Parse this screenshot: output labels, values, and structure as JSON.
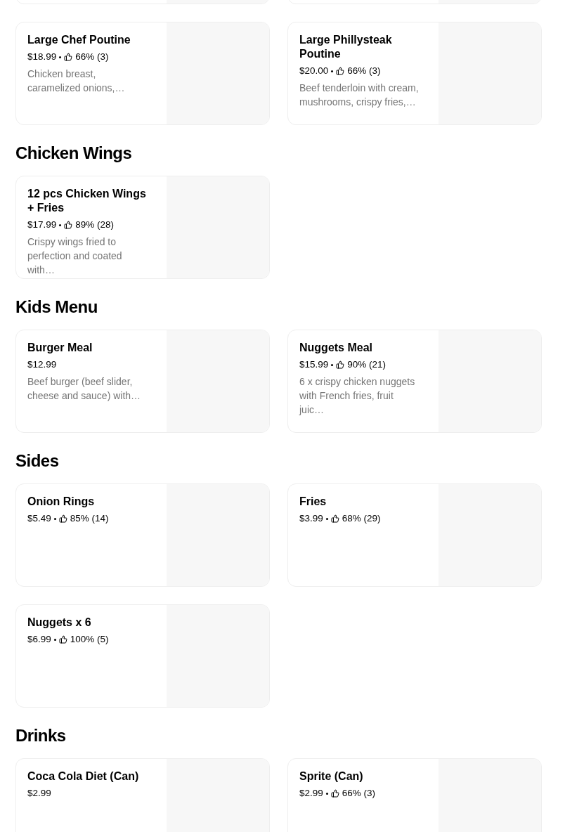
{
  "sections": [
    {
      "items": [
        {
          "name": "Large Chef Poutine",
          "price": "$18.99",
          "rating": "66% (3)",
          "description": "Chicken breast, caramelized onions,…"
        },
        {
          "name": "Large Phillysteak Poutine",
          "price": "$20.00",
          "rating": "66% (3)",
          "description": "Beef tenderloin with cream, mushrooms, crispy fries,…"
        }
      ]
    },
    {
      "title": "Chicken Wings",
      "items": [
        {
          "name": "12 pcs Chicken Wings + Fries",
          "price": "$17.99",
          "rating": "89% (28)",
          "description": "Crispy wings fried to perfection and coated with…"
        }
      ]
    },
    {
      "title": "Kids Menu",
      "items": [
        {
          "name": "Burger Meal",
          "price": "$12.99",
          "description": "Beef burger (beef slider, cheese and sauce) with…"
        },
        {
          "name": "Nuggets Meal",
          "price": "$15.99",
          "rating": "90% (21)",
          "description": "6 x crispy chicken nuggets with French fries, fruit juic…"
        }
      ]
    },
    {
      "title": "Sides",
      "items": [
        {
          "name": "Onion Rings",
          "price": "$5.49",
          "rating": "85% (14)"
        },
        {
          "name": "Fries",
          "price": "$3.99",
          "rating": "68% (29)"
        },
        {
          "name": "Nuggets x 6",
          "price": "$6.99",
          "rating": "100% (5)"
        }
      ]
    },
    {
      "title": "Drinks",
      "items": [
        {
          "name": "Coca Cola Diet (Can)",
          "price": "$2.99"
        },
        {
          "name": "Sprite (Can)",
          "price": "$2.99",
          "rating": "66% (3)"
        }
      ]
    }
  ]
}
